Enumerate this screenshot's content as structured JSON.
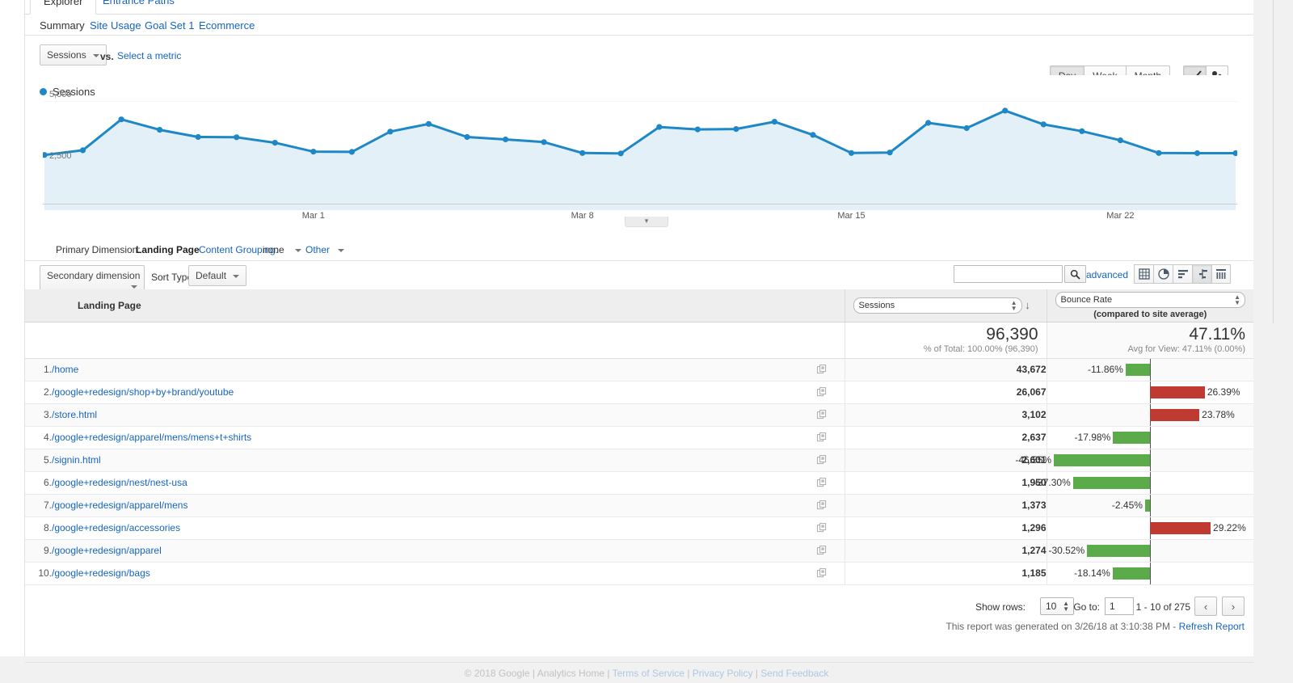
{
  "tabs": [
    {
      "label": "Explorer",
      "active": true
    },
    {
      "label": "Entrance Paths",
      "active": false
    }
  ],
  "subnav": [
    {
      "label": "Summary",
      "selected": true
    },
    {
      "label": "Site Usage",
      "selected": false
    },
    {
      "label": "Goal Set 1",
      "selected": false
    },
    {
      "label": "Ecommerce",
      "selected": false
    }
  ],
  "metric_row": {
    "primary_metric": "Sessions",
    "vs_label": "vs.",
    "select_metric_link": "Select a metric"
  },
  "granularity": {
    "options": [
      "Day",
      "Week",
      "Month"
    ],
    "selected": "Day"
  },
  "chart_mode": {
    "options": [
      "line-chart-icon",
      "motion-chart-icon"
    ],
    "selected": "line-chart-icon"
  },
  "chart_data": {
    "type": "line",
    "title": "Sessions",
    "legend": [
      "Sessions"
    ],
    "legend_position": "top-left",
    "series_color": "#1e88c7",
    "fill_color": "#e4f0f7",
    "grid": true,
    "xlabel": "",
    "ylabel": "",
    "ylim": [
      0,
      5000
    ],
    "yticks": [
      2500,
      5000
    ],
    "ytick_labels": [
      "2,500",
      "5,000"
    ],
    "xticks": [
      "Mar 1",
      "Mar 8",
      "Mar 15",
      "Mar 22"
    ],
    "xtick_positions": [
      7,
      14,
      21,
      28
    ],
    "x": [
      1,
      2,
      3,
      4,
      5,
      6,
      7,
      8,
      9,
      10,
      11,
      12,
      13,
      14,
      15,
      16,
      17,
      18,
      19,
      20,
      21,
      22,
      23,
      24,
      25,
      26,
      27,
      28,
      29,
      30,
      31,
      32
    ],
    "values": [
      2530,
      2745,
      4160,
      3680,
      3350,
      3340,
      3090,
      2680,
      2670,
      3600,
      3950,
      3350,
      3240,
      3120,
      2620,
      2600,
      3810,
      3700,
      3720,
      4050,
      3450,
      2620,
      2640,
      4000,
      3760,
      4560,
      3930,
      3620,
      3200,
      2620,
      2610,
      2610
    ]
  },
  "chart_expander": "▾",
  "primary_dimension": {
    "label": "Primary Dimension:",
    "selected": "Landing Page",
    "content_grouping_label": "Content Grouping:",
    "content_grouping_value": "none",
    "other_label": "Other"
  },
  "table_controls": {
    "secondary_dimension": "Secondary dimension",
    "sort_type_label": "Sort Type:",
    "sort_type_value": "Default",
    "search_value": "",
    "search_placeholder": "",
    "advanced_link": "advanced",
    "view_icons": [
      {
        "name": "table-view-icon",
        "active": false
      },
      {
        "name": "pie-chart-view-icon",
        "active": false
      },
      {
        "name": "performance-view-icon",
        "active": false
      },
      {
        "name": "comparison-view-icon",
        "active": true
      },
      {
        "name": "pivot-view-icon",
        "active": false
      }
    ]
  },
  "table": {
    "dimension_header": "Landing Page",
    "metric_header": "Sessions",
    "compare_header": "Bounce Rate",
    "compare_subtitle": "(compared to site average)",
    "totals": {
      "metric_value": "96,390",
      "metric_sub": "% of Total: 100.00% (96,390)",
      "compare_value": "47.11%",
      "compare_sub": "Avg for View: 47.11% (0.00%)"
    },
    "rows": [
      {
        "index": "1.",
        "page": "/home",
        "sessions": "43,672",
        "bounce": "-11.86%",
        "bounce_value": -11.86
      },
      {
        "index": "2.",
        "page": "/google+redesign/shop+by+brand/youtube",
        "sessions": "26,067",
        "bounce": "26.39%",
        "bounce_value": 26.39
      },
      {
        "index": "3.",
        "page": "/store.html",
        "sessions": "3,102",
        "bounce": "23.78%",
        "bounce_value": 23.78
      },
      {
        "index": "4.",
        "page": "/google+redesign/apparel/mens/mens+t+shirts",
        "sessions": "2,637",
        "bounce": "-17.98%",
        "bounce_value": -17.98
      },
      {
        "index": "5.",
        "page": "/signin.html",
        "sessions": "2,601",
        "bounce": "-46.55%",
        "bounce_value": -46.55
      },
      {
        "index": "6.",
        "page": "/google+redesign/nest/nest-usa",
        "sessions": "1,950",
        "bounce": "-37.30%",
        "bounce_value": -37.3
      },
      {
        "index": "7.",
        "page": "/google+redesign/apparel/mens",
        "sessions": "1,373",
        "bounce": "-2.45%",
        "bounce_value": -2.45
      },
      {
        "index": "8.",
        "page": "/google+redesign/accessories",
        "sessions": "1,296",
        "bounce": "29.22%",
        "bounce_value": 29.22
      },
      {
        "index": "9.",
        "page": "/google+redesign/apparel",
        "sessions": "1,274",
        "bounce": "-30.52%",
        "bounce_value": -30.52
      },
      {
        "index": "10.",
        "page": "/google+redesign/bags",
        "sessions": "1,185",
        "bounce": "-18.14%",
        "bounce_value": -18.14
      }
    ],
    "bar_colors": {
      "negative": "#5cab4b",
      "positive": "#bf3a31"
    },
    "bar_max_pct": 50
  },
  "pagination": {
    "show_rows_label": "Show rows:",
    "show_rows_value": "10",
    "goto_label": "Go to:",
    "goto_value": "1",
    "range_text": "1 - 10 of 275",
    "prev_icon": "‹",
    "next_icon": "›"
  },
  "report_footer": {
    "generated_text": "This report was generated on 3/26/18 at 3:10:38 PM - ",
    "refresh_link": "Refresh Report"
  },
  "ga_footer": {
    "copyright": "© 2018 Google | Analytics Home | ",
    "terms": "Terms of Service",
    "sep1": " | ",
    "privacy": "Privacy Policy",
    "sep2": " | ",
    "feedback": "Send Feedback"
  }
}
